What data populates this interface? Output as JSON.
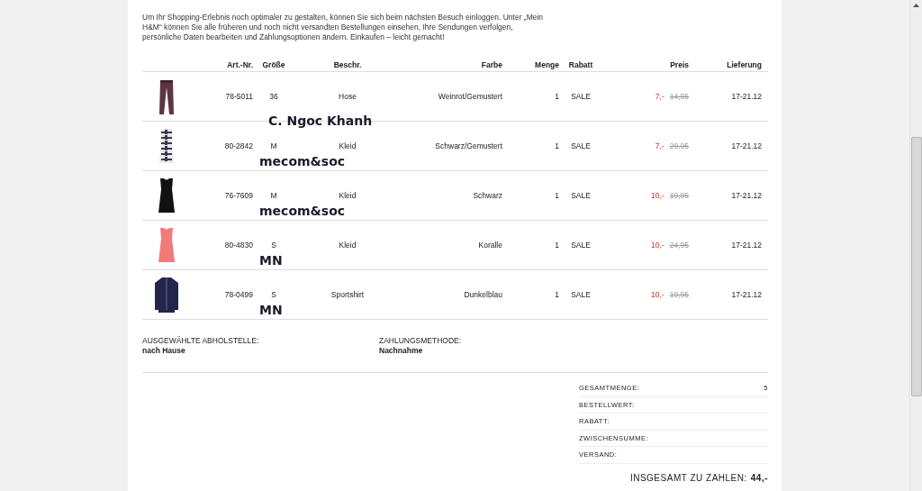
{
  "intro": "Um Ihr Shopping-Erlebnis noch optimaler zu gestalten, können Sie sich beim nächsten Besuch einloggen. Unter „Mein H&M“ können Sie alle früheren und noch nicht versandten Bestellungen einsehen, Ihre Sendungen verfolgen, persönliche Daten bearbeiten und Zahlungsoptionen ändern. Einkaufen – leicht gemacht!",
  "table": {
    "columns": [
      "Art.-Nr.",
      "Größe",
      "Beschr.",
      "Farbe",
      "Menge",
      "Rabatt",
      "Preis",
      "Lieferung"
    ],
    "rows": [
      {
        "article": "78-5011",
        "size": "36",
        "description": "Hose",
        "color_name": "Weinrot/Gemustert",
        "quantity": "1",
        "discount": "SALE",
        "price": "7,-",
        "old_price": "14,95",
        "delivery": "17-21.12",
        "annotation": "C. Ngoc Khanh"
      },
      {
        "article": "80-2842",
        "size": "M",
        "description": "Kleid",
        "color_name": "Schwarz/Gemustert",
        "quantity": "1",
        "discount": "SALE",
        "price": "7,-",
        "old_price": "29,95",
        "delivery": "17-21.12",
        "annotation": "mecom&soc"
      },
      {
        "article": "76-7609",
        "size": "M",
        "description": "Kleid",
        "color_name": "Schwarz",
        "quantity": "1",
        "discount": "SALE",
        "price": "10,-",
        "old_price": "19,95",
        "delivery": "17-21.12",
        "annotation": "mecom&soc"
      },
      {
        "article": "80-4830",
        "size": "S",
        "description": "Kleid",
        "color_name": "Koralle",
        "quantity": "1",
        "discount": "SALE",
        "price": "10,-",
        "old_price": "24,95",
        "delivery": "17-21.12",
        "annotation": "MN"
      },
      {
        "article": "78-0499",
        "size": "S",
        "description": "Sportshirt",
        "color_name": "Dunkelblau",
        "quantity": "1",
        "discount": "SALE",
        "price": "10,-",
        "old_price": "19,95",
        "delivery": "17-21.12",
        "annotation": "MN"
      }
    ]
  },
  "pickup": {
    "label": "AUSGEWÄHLTE ABHOLSTELLE:",
    "value": "nach Hause"
  },
  "payment": {
    "label": "ZAHLUNGSMETHODE:",
    "value": "Nachnahme"
  },
  "summary": [
    {
      "label": "GESAMTMENGE:",
      "value": "5"
    },
    {
      "label": "BESTELLWERT:"
    },
    {
      "label": "RABATT:"
    },
    {
      "label": "ZWISCHENSUMME:"
    },
    {
      "label": "VERSAND:"
    }
  ],
  "total": {
    "label": "INSGESAMT ZU ZAHLEN:",
    "value": "44,-"
  }
}
